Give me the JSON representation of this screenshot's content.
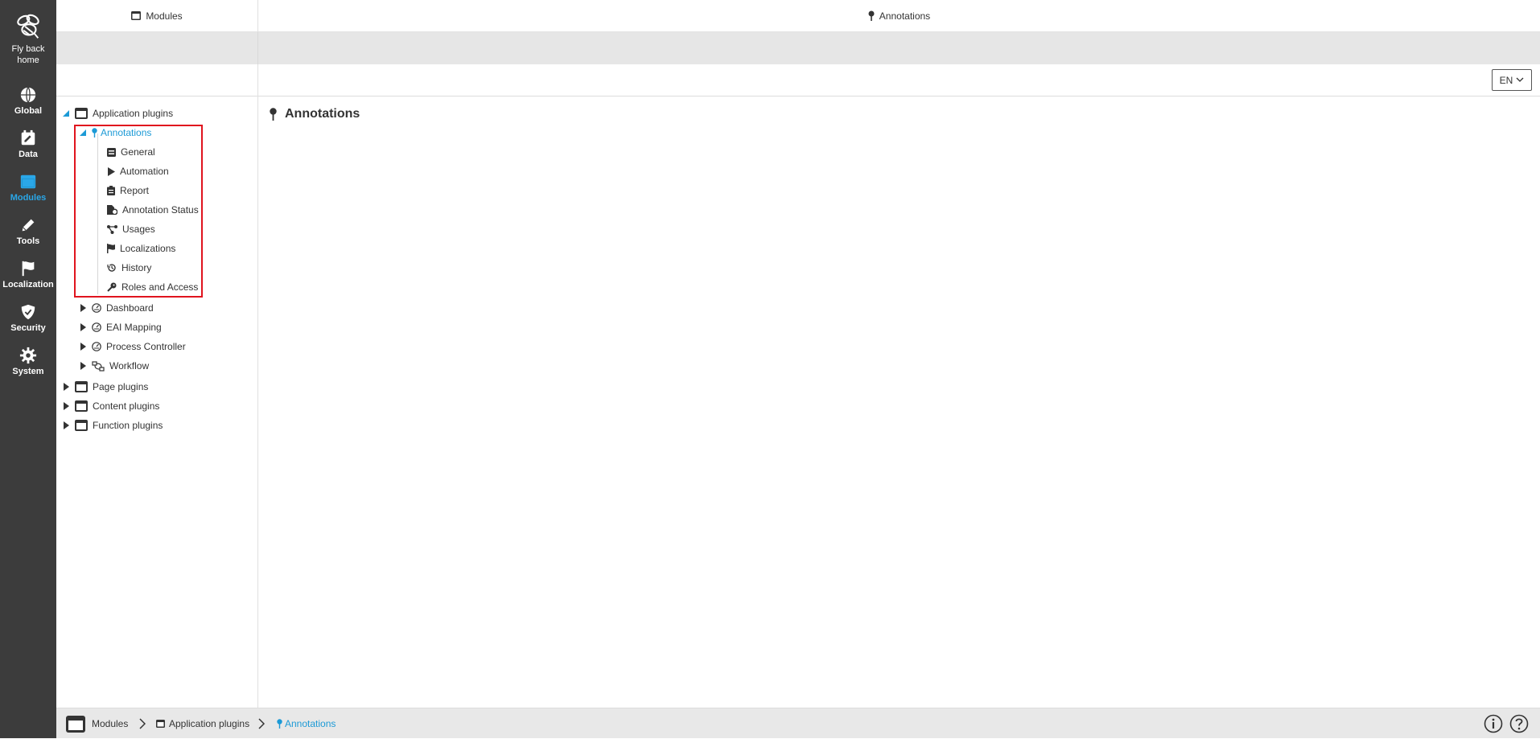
{
  "rail": {
    "home": {
      "line1": "Fly back",
      "line2": "home",
      "icon": "bee-logo-icon"
    },
    "items": [
      {
        "label": "Global",
        "icon": "globe-icon"
      },
      {
        "label": "Data",
        "icon": "edit-square-icon"
      },
      {
        "label": "Modules",
        "icon": "window-icon"
      },
      {
        "label": "Tools",
        "icon": "pencil-icon"
      },
      {
        "label": "Localization",
        "icon": "flag-icon"
      },
      {
        "label": "Security",
        "icon": "shield-check-icon"
      },
      {
        "label": "System",
        "icon": "gear-icon"
      }
    ],
    "active": "Modules",
    "active_color": "#2aa7e8"
  },
  "header": {
    "left_title": "Modules",
    "right_title": "Annotations"
  },
  "toolbar": {
    "language": "EN"
  },
  "tree": {
    "root": "Application plugins",
    "selected": "Annotations",
    "selected_children": [
      {
        "label": "General",
        "icon": "list-box-icon"
      },
      {
        "label": "Automation",
        "icon": "play-icon"
      },
      {
        "label": "Report",
        "icon": "clipboard-icon"
      },
      {
        "label": "Annotation Status",
        "icon": "file-gear-icon"
      },
      {
        "label": "Usages",
        "icon": "share-nodes-icon"
      },
      {
        "label": "Localizations",
        "icon": "flag-icon"
      },
      {
        "label": "History",
        "icon": "history-icon"
      },
      {
        "label": "Roles and Access",
        "icon": "key-icon"
      }
    ],
    "siblings": [
      {
        "label": "Dashboard",
        "icon": "gauge-icon"
      },
      {
        "label": "EAI Mapping",
        "icon": "gauge-icon"
      },
      {
        "label": "Process Controller",
        "icon": "gauge-icon"
      },
      {
        "label": "Workflow",
        "icon": "workflow-icon"
      }
    ],
    "roots": [
      {
        "label": "Page plugins"
      },
      {
        "label": "Content plugins"
      },
      {
        "label": "Function plugins"
      }
    ],
    "highlight_color": "#e0141e",
    "selected_color": "#1c9ad6"
  },
  "main": {
    "title": "Annotations"
  },
  "footer": {
    "breadcrumbs": [
      "Modules",
      "Application plugins",
      "Annotations"
    ],
    "info_icon": "info-icon",
    "help_icon": "help-icon"
  }
}
